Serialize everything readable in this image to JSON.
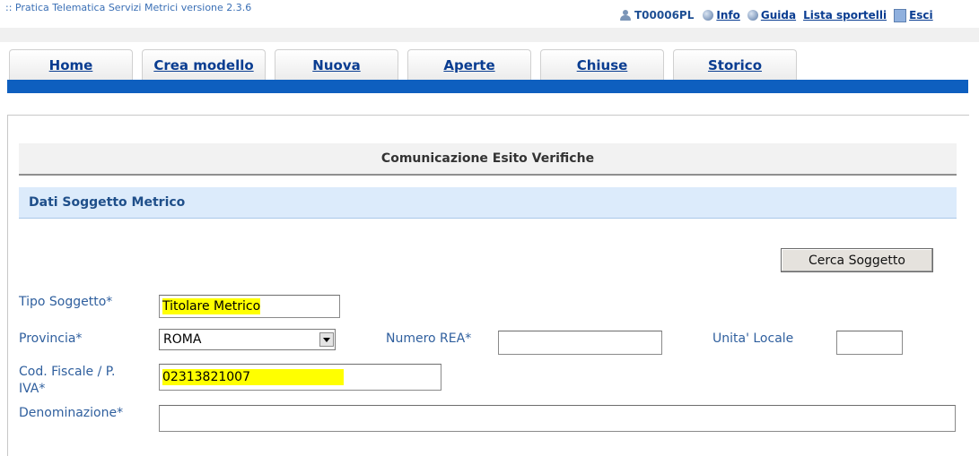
{
  "app": {
    "title": ":: Pratica Telematica Servizi Metrici versione 2.3.6"
  },
  "topnav": {
    "user_code": "T00006PL",
    "info": "Info",
    "guida": "Guida",
    "lista_sportelli": "Lista sportelli",
    "esci": "Esci"
  },
  "tabs": [
    {
      "label": "Home"
    },
    {
      "label": "Crea modello"
    },
    {
      "label": "Nuova"
    },
    {
      "label": "Aperte"
    },
    {
      "label": "Chiuse"
    },
    {
      "label": "Storico"
    }
  ],
  "section": {
    "title": "Comunicazione Esito Verifiche"
  },
  "subsection": {
    "title": "Dati Soggetto Metrico"
  },
  "buttons": {
    "cerca": "Cerca Soggetto"
  },
  "form": {
    "tipo_soggetto": {
      "label": "Tipo Soggetto*",
      "value": "Titolare Metrico"
    },
    "provincia": {
      "label": "Provincia*",
      "value": "ROMA"
    },
    "numero_rea": {
      "label": "Numero REA*",
      "value": ""
    },
    "unita_locale": {
      "label": "Unita' Locale",
      "value": ""
    },
    "cod_fiscale": {
      "label_line1": "Cod. Fiscale / P.",
      "label_line2": "IVA*",
      "value": "02313821007"
    },
    "denominazione": {
      "label": "Denominazione*",
      "value": ""
    }
  },
  "colors": {
    "accent_bar": "#0e5fbf",
    "highlight": "#ffff00",
    "subheader_bg": "#dcebfb"
  }
}
